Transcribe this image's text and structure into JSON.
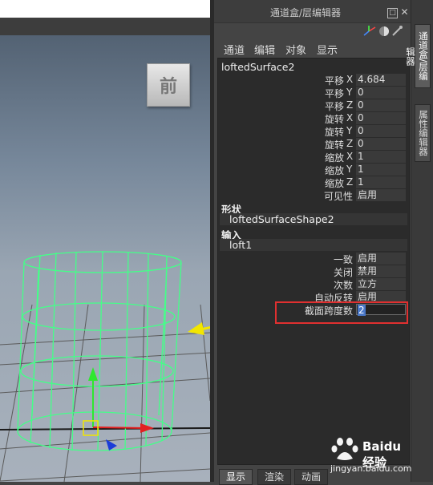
{
  "viewport": {
    "view_cube_label": "前"
  },
  "panel": {
    "title": "通道盒/层编辑器",
    "float_icon": "□",
    "close_icon": "✕",
    "menus": [
      "通道",
      "编辑",
      "对象",
      "显示"
    ],
    "node_name": "loftedSurface2",
    "attributes": [
      {
        "label": "平移",
        "axis": "X",
        "value": "4.684"
      },
      {
        "label": "平移",
        "axis": "Y",
        "value": "0"
      },
      {
        "label": "平移",
        "axis": "Z",
        "value": "0"
      },
      {
        "label": "旋转",
        "axis": "X",
        "value": "0"
      },
      {
        "label": "旋转",
        "axis": "Y",
        "value": "0"
      },
      {
        "label": "旋转",
        "axis": "Z",
        "value": "0"
      },
      {
        "label": "缩放",
        "axis": "X",
        "value": "1"
      },
      {
        "label": "缩放",
        "axis": "Y",
        "value": "1"
      },
      {
        "label": "缩放",
        "axis": "Z",
        "value": "1"
      },
      {
        "label": "可见性",
        "axis": "",
        "value": "启用"
      }
    ],
    "shapes_header": "形状",
    "shape_name": "loftedSurfaceShape2",
    "inputs_header": "输入",
    "input_name": "loft1",
    "loft_attributes": [
      {
        "label": "一致",
        "value": "启用"
      },
      {
        "label": "关闭",
        "value": "禁用"
      },
      {
        "label": "次数",
        "value": "立方"
      },
      {
        "label": "自动反转",
        "value": "启用"
      }
    ],
    "span_label": "截面跨度数",
    "span_value": "2",
    "bottom_tabs": [
      "显示",
      "渲染",
      "动画"
    ]
  },
  "side_tabs": [
    "通道盒/层编辑器",
    "属性编辑器"
  ],
  "watermark": {
    "name": "Baidu经验",
    "url": "jingyan.baidu.com"
  },
  "colors": {
    "wire": "#44ff88",
    "highlight": "#e03030",
    "arrow": "#f2e600"
  }
}
